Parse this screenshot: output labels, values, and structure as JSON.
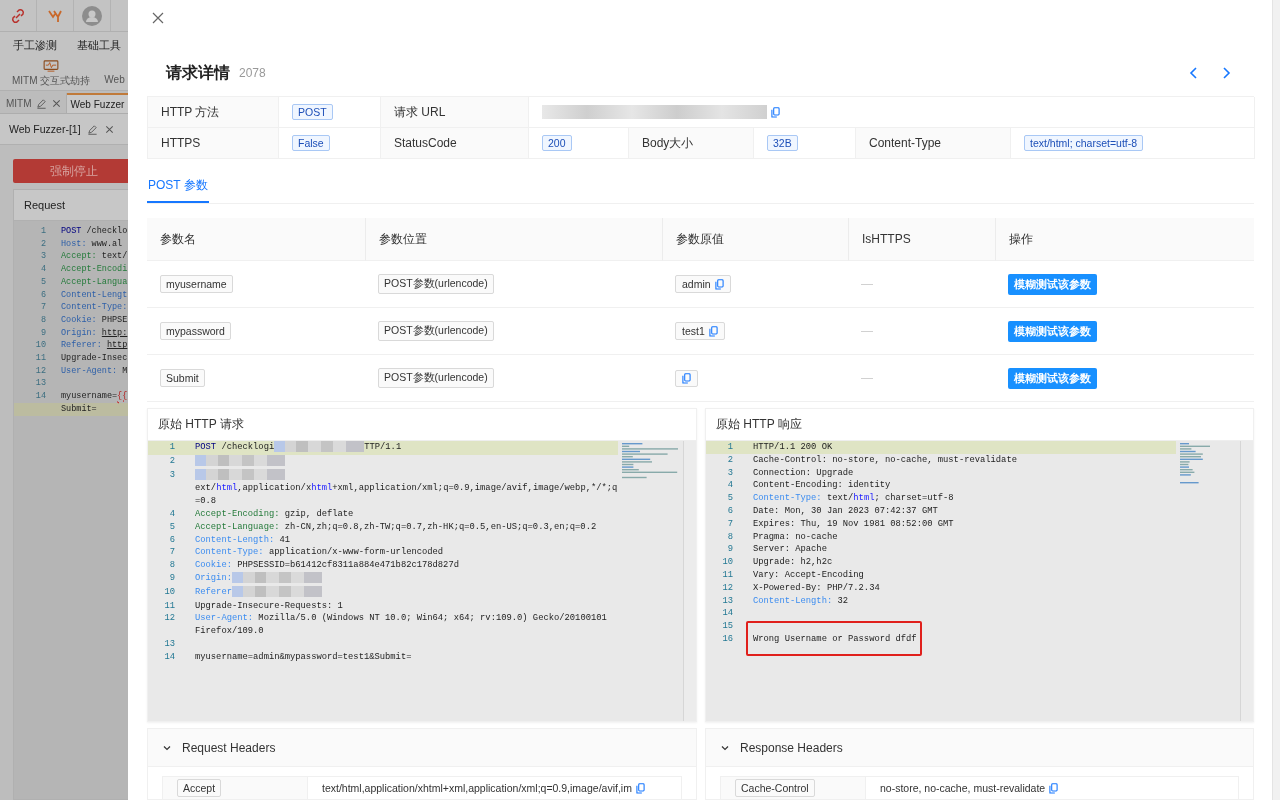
{
  "background_app": {
    "menu": [
      "手工渗测",
      "基础工具"
    ],
    "tools": [
      "MITM 交互式劫持",
      "Web"
    ],
    "tabs": [
      {
        "label": "MITM",
        "selected": false
      },
      {
        "label": "Web Fuzzer",
        "selected": true
      }
    ],
    "subtab": "Web Fuzzer-[1]",
    "stop_button": "强制停止",
    "request_title": "Request",
    "request_lines": [
      {
        "n": "1",
        "highlighted": false,
        "parts": [
          {
            "kind": "method",
            "text": "POST"
          },
          {
            "kind": "plain",
            "text": " /checklo"
          }
        ]
      },
      {
        "n": "2",
        "highlighted": false,
        "parts": [
          {
            "kind": "blue",
            "text": "Host:"
          },
          {
            "kind": "plain",
            "text": " www.al"
          }
        ]
      },
      {
        "n": "3",
        "highlighted": false,
        "parts": [
          {
            "kind": "green",
            "text": "Accept:"
          },
          {
            "kind": "plain",
            "text": " text/"
          }
        ]
      },
      {
        "n": "4",
        "highlighted": false,
        "parts": [
          {
            "kind": "green",
            "text": "Accept-Encodi"
          }
        ]
      },
      {
        "n": "5",
        "highlighted": false,
        "parts": [
          {
            "kind": "green",
            "text": "Accept-Langua"
          }
        ]
      },
      {
        "n": "6",
        "highlighted": false,
        "parts": [
          {
            "kind": "blue",
            "text": "Content-Lengt"
          }
        ]
      },
      {
        "n": "7",
        "highlighted": false,
        "parts": [
          {
            "kind": "blue",
            "text": "Content-Type:"
          }
        ]
      },
      {
        "n": "8",
        "highlighted": false,
        "parts": [
          {
            "kind": "blue",
            "text": "Cookie:"
          },
          {
            "kind": "plain",
            "text": " PHPSE"
          }
        ]
      },
      {
        "n": "9",
        "highlighted": false,
        "parts": [
          {
            "kind": "blue",
            "text": "Origin: "
          },
          {
            "kind": "underline",
            "text": "http:"
          }
        ]
      },
      {
        "n": "10",
        "highlighted": false,
        "parts": [
          {
            "kind": "blue",
            "text": "Referer: "
          },
          {
            "kind": "underline",
            "text": "http"
          }
        ]
      },
      {
        "n": "11",
        "highlighted": false,
        "parts": [
          {
            "kind": "plain",
            "text": "Upgrade-Insec"
          }
        ]
      },
      {
        "n": "12",
        "highlighted": false,
        "parts": [
          {
            "kind": "blue",
            "text": "User-Agent:"
          },
          {
            "kind": "plain",
            "text": " M"
          }
        ]
      },
      {
        "n": "13",
        "highlighted": false
      },
      {
        "n": "14",
        "highlighted": false,
        "parts": [
          {
            "kind": "plain",
            "text": "myusername="
          },
          {
            "kind": "error",
            "text": "{{"
          }
        ]
      },
      {
        "highlighted": true,
        "parts": [
          {
            "kind": "plain",
            "text": "Submit="
          }
        ]
      }
    ]
  },
  "drawer": {
    "title": "请求详情",
    "count": "2078",
    "info_rows": [
      [
        {
          "kind": "label",
          "text": "HTTP 方法"
        },
        {
          "kind": "tag",
          "text": "POST"
        },
        {
          "kind": "label",
          "text": "请求 URL"
        },
        {
          "kind": "url"
        }
      ],
      [
        {
          "kind": "label",
          "text": "HTTPS"
        },
        {
          "kind": "tag",
          "text": "False"
        },
        {
          "kind": "label",
          "text": "StatusCode"
        },
        {
          "kind": "tag",
          "text": "200"
        },
        {
          "kind": "label",
          "text": "Body大小"
        },
        {
          "kind": "tag",
          "text": "32B"
        },
        {
          "kind": "label",
          "text": "Content-Type"
        },
        {
          "kind": "tag",
          "text": "text/html; charset=utf-8"
        }
      ]
    ],
    "tabs": [
      {
        "label": "POST 参数",
        "selected": true
      }
    ],
    "params": {
      "columns": [
        "参数名",
        "参数位置",
        "参数原值",
        "IsHTTPS",
        "操作"
      ],
      "rows": [
        {
          "name": "myusername",
          "position": "POST参数(urlencode)",
          "value": "admin",
          "https": "—",
          "action": "模糊测试该参数"
        },
        {
          "name": "mypassword",
          "position": "POST参数(urlencode)",
          "value": "test1",
          "https": "—",
          "action": "模糊测试该参数"
        },
        {
          "name": "Submit",
          "position": "POST参数(urlencode)",
          "https": "—",
          "action": "模糊测试该参数"
        }
      ]
    },
    "raw_request": {
      "title": "原始 HTTP 请求",
      "lines": [
        {
          "n": "1",
          "highlighted": true,
          "parts": [
            {
              "kind": "method",
              "text": "POST"
            },
            {
              "kind": "plain",
              "text": " /checklogi"
            },
            {
              "kind": "redacted"
            },
            {
              "kind": "plain",
              "text": "TTP/1.1"
            }
          ]
        },
        {
          "n": "2",
          "highlighted": false,
          "parts": [
            {
              "kind": "redacted"
            }
          ]
        },
        {
          "n": "3",
          "highlighted": false,
          "parts": [
            {
              "kind": "redacted"
            },
            {
              "kind": "plain",
              "text": "ext/"
            },
            {
              "kind": "link",
              "text": "html"
            },
            {
              "kind": "plain",
              "text": ",application/x"
            },
            {
              "kind": "link",
              "text": "html"
            },
            {
              "kind": "plain",
              "text": "+xml,application/xml;q=0.9,image/avif,image/webp,*/*;q=0.8"
            }
          ]
        },
        {
          "n": "4",
          "highlighted": false,
          "parts": [
            {
              "kind": "green",
              "text": "Accept-Encoding:"
            },
            {
              "kind": "plain",
              "text": " gzip, deflate"
            }
          ]
        },
        {
          "n": "5",
          "highlighted": false,
          "parts": [
            {
              "kind": "green",
              "text": "Accept-Language:"
            },
            {
              "kind": "plain",
              "text": " zh-CN,zh;q=0.8,zh-TW;q=0.7,zh-HK;q=0.5,en-US;q=0.3,en;q=0.2"
            }
          ]
        },
        {
          "n": "6",
          "highlighted": false,
          "parts": [
            {
              "kind": "blue",
              "text": "Content-Length:"
            },
            {
              "kind": "plain",
              "text": " 41"
            }
          ]
        },
        {
          "n": "7",
          "highlighted": false,
          "parts": [
            {
              "kind": "blue",
              "text": "Content-Type:"
            },
            {
              "kind": "plain",
              "text": " application/x-www-form-urlencoded"
            }
          ]
        },
        {
          "n": "8",
          "highlighted": false,
          "parts": [
            {
              "kind": "blue",
              "text": "Cookie:"
            },
            {
              "kind": "plain",
              "text": " PHPSESSID=b61412cf8311a884e471b82c178d827d"
            }
          ]
        },
        {
          "n": "9",
          "highlighted": false,
          "parts": [
            {
              "kind": "blue",
              "text": "Origin:"
            },
            {
              "kind": "redacted"
            }
          ]
        },
        {
          "n": "10",
          "highlighted": false,
          "parts": [
            {
              "kind": "blue",
              "text": "Referer"
            },
            {
              "kind": "redacted"
            }
          ]
        },
        {
          "n": "11",
          "highlighted": false,
          "parts": [
            {
              "kind": "plain",
              "text": "Upgrade-Insecure-Requests: 1"
            }
          ]
        },
        {
          "n": "12",
          "highlighted": false,
          "parts": [
            {
              "kind": "blue",
              "text": "User-Agent:"
            },
            {
              "kind": "plain",
              "text": " Mozilla/5.0 (Windows NT 10.0; Win64; x64; rv:109.0) Gecko/20100101 Firefox/109.0"
            }
          ]
        },
        {
          "n": "13",
          "highlighted": false
        },
        {
          "n": "14",
          "highlighted": false,
          "parts": [
            {
              "kind": "plain",
              "text": "myusername=admin&mypassword=test1&Submit="
            }
          ]
        }
      ]
    },
    "raw_response": {
      "title": "原始 HTTP 响应",
      "lines": [
        {
          "n": "1",
          "highlighted": true,
          "boxed": false,
          "parts": [
            {
              "kind": "plain",
              "text": "HTTP/1.1 200 OK"
            }
          ]
        },
        {
          "n": "2",
          "highlighted": false,
          "boxed": false,
          "parts": [
            {
              "kind": "plain",
              "text": "Cache-Control: no-store, no-cache, must-revalidate"
            }
          ]
        },
        {
          "n": "3",
          "highlighted": false,
          "boxed": false,
          "parts": [
            {
              "kind": "plain",
              "text": "Connection: Upgrade"
            }
          ]
        },
        {
          "n": "4",
          "highlighted": false,
          "boxed": false,
          "parts": [
            {
              "kind": "plain",
              "text": "Content-Encoding: identity"
            }
          ]
        },
        {
          "n": "5",
          "highlighted": false,
          "boxed": false,
          "parts": [
            {
              "kind": "blue",
              "text": "Content-Type:"
            },
            {
              "kind": "plain",
              "text": " text/"
            },
            {
              "kind": "link",
              "text": "html"
            },
            {
              "kind": "plain",
              "text": "; charset=utf-8"
            }
          ]
        },
        {
          "n": "6",
          "highlighted": false,
          "boxed": false,
          "parts": [
            {
              "kind": "plain",
              "text": "Date: Mon, 30 Jan 2023 07:42:37 GMT"
            }
          ]
        },
        {
          "n": "7",
          "highlighted": false,
          "boxed": false,
          "parts": [
            {
              "kind": "plain",
              "text": "Expires: Thu, 19 Nov 1981 08:52:00 GMT"
            }
          ]
        },
        {
          "n": "8",
          "highlighted": false,
          "boxed": false,
          "parts": [
            {
              "kind": "plain",
              "text": "Pragma: no-cache"
            }
          ]
        },
        {
          "n": "9",
          "highlighted": false,
          "boxed": false,
          "parts": [
            {
              "kind": "plain",
              "text": "Server: Apache"
            }
          ]
        },
        {
          "n": "10",
          "highlighted": false,
          "boxed": false,
          "parts": [
            {
              "kind": "plain",
              "text": "Upgrade: h2,h2c"
            }
          ]
        },
        {
          "n": "11",
          "highlighted": false,
          "boxed": false,
          "parts": [
            {
              "kind": "plain",
              "text": "Vary: Accept-Encoding"
            }
          ]
        },
        {
          "n": "12",
          "highlighted": false,
          "boxed": false,
          "parts": [
            {
              "kind": "plain",
              "text": "X-Powered-By: PHP/7.2.34"
            }
          ]
        },
        {
          "n": "13",
          "highlighted": false,
          "boxed": false,
          "parts": [
            {
              "kind": "blue",
              "text": "Content-Length:"
            },
            {
              "kind": "plain",
              "text": " 32"
            }
          ]
        },
        {
          "n": "14",
          "highlighted": false
        },
        {
          "n": "15",
          "highlighted": false
        },
        {
          "n": "16",
          "highlighted": false,
          "boxed": true,
          "parts": [
            {
              "kind": "plain",
              "text": "Wrong Username or Password dfdf"
            }
          ]
        }
      ]
    },
    "request_headers": {
      "title": "Request Headers",
      "expanded": true,
      "rows": [
        {
          "name": "Accept",
          "value": "text/html,application/xhtml+xml,application/xml;q=0.9,image/avif,im"
        }
      ]
    },
    "response_headers": {
      "title": "Response Headers",
      "expanded": true,
      "rows": [
        {
          "name": "Cache-Control",
          "value": "no-store, no-cache, must-revalidate"
        }
      ]
    }
  }
}
